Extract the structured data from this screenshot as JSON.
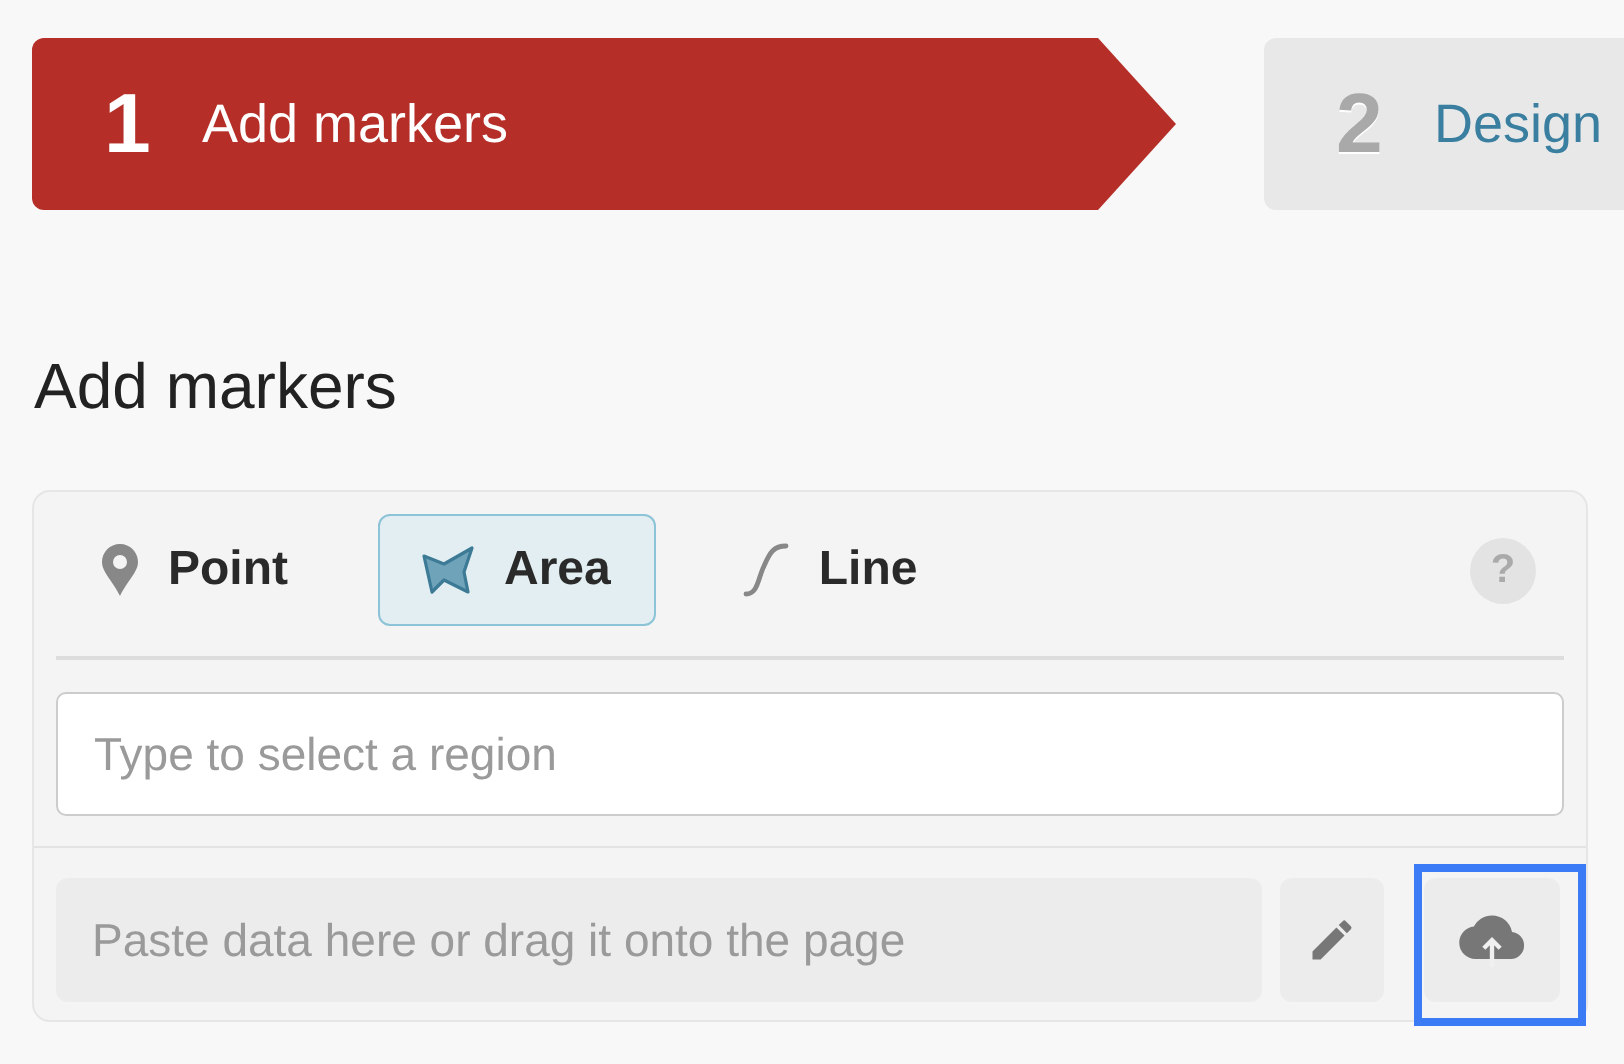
{
  "steps": [
    {
      "number": "1",
      "label": "Add markers",
      "selected": true
    },
    {
      "number": "2",
      "label": "Design",
      "selected": false
    }
  ],
  "heading": "Add markers",
  "tabs": [
    {
      "kind": "point",
      "label": "Point",
      "selected": false
    },
    {
      "kind": "area",
      "label": "Area",
      "selected": true
    },
    {
      "kind": "line",
      "label": "Line",
      "selected": false
    }
  ],
  "help": "?",
  "region_field": {
    "placeholder": "Type to select a region"
  },
  "data_field": {
    "placeholder": "Paste data here or drag it onto the page"
  },
  "buttons": [
    {
      "kind": "edit",
      "highlighted": false
    },
    {
      "kind": "upload",
      "highlighted": true
    }
  ]
}
